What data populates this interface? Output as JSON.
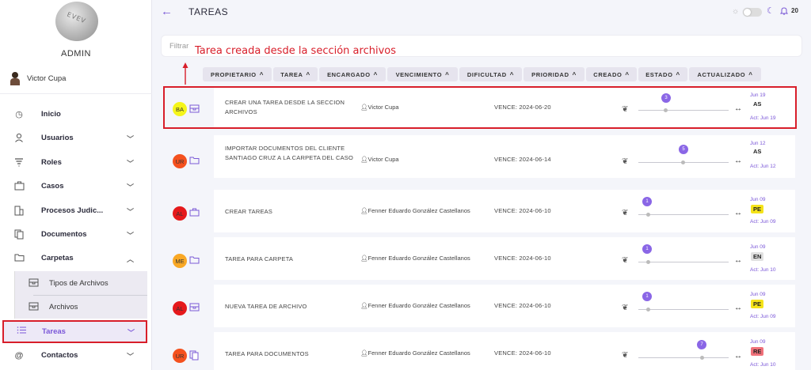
{
  "sidebar": {
    "admin_label": "ADMIN",
    "user_name": "Victor Cupa",
    "items": [
      {
        "label": "Inicio",
        "icon": "clock-icon"
      },
      {
        "label": "Usuarios",
        "icon": "user-icon"
      },
      {
        "label": "Roles",
        "icon": "roles-icon"
      },
      {
        "label": "Casos",
        "icon": "briefcase-icon"
      },
      {
        "label": "Procesos Judic...",
        "icon": "building-icon"
      },
      {
        "label": "Documentos",
        "icon": "documents-icon"
      },
      {
        "label": "Carpetas",
        "icon": "folder-icon"
      },
      {
        "label": "Tareas",
        "icon": "list-icon"
      },
      {
        "label": "Contactos",
        "icon": "at-icon"
      }
    ],
    "sub_items": [
      {
        "label": "Tipos de Archivos",
        "icon": "archive-box-icon"
      },
      {
        "label": "Archivos",
        "icon": "archive-box-icon"
      }
    ]
  },
  "header": {
    "title": "TAREAS",
    "notifications": "20"
  },
  "filter": {
    "placeholder": "Filtrar"
  },
  "annotation": "Tarea creada desde la sección archivos",
  "columns": [
    "PROPIETARIO",
    "TAREA",
    "ENCARGADO",
    "VENCIMIENTO",
    "DIFICULTAD",
    "PRIORIDAD",
    "CREADO",
    "ESTADO",
    "ACTUALIZADO"
  ],
  "rows": [
    {
      "initials": "BA",
      "badge_color": "#f5f51a",
      "type_icon": "archive-box-icon",
      "title": "CREAR UNA TAREA DESDE LA SECCION ARCHIVOS",
      "owner": "Victor Cupa",
      "due": "VENCE: 2024-06-20",
      "priority_label": "3",
      "priority": 3,
      "created": "Jun 19",
      "status": "AS",
      "status_color": "#ffffff",
      "updated": "Act: Jun 19"
    },
    {
      "initials": "UR",
      "badge_color": "#f4511e",
      "type_icon": "folder-icon",
      "title": "IMPORTAR DOCUMENTOS DEL CLIENTE SANTIAGO CRUZ A LA CARPETA DEL CASO",
      "owner": "Victor Cupa",
      "due": "VENCE: 2024-06-14",
      "priority_label": "5",
      "priority": 5,
      "created": "Jun 12",
      "status": "AS",
      "status_color": "#ffffff",
      "updated": "Act: Jun 12"
    },
    {
      "initials": "AL",
      "badge_color": "#e5191b",
      "type_icon": "briefcase-icon",
      "title": "CREAR TAREAS",
      "owner": "Fenner Eduardo González Castellanos",
      "due": "VENCE: 2024-06-10",
      "priority_label": "1",
      "priority": 1,
      "created": "Jun 09",
      "status": "PE",
      "status_color": "#f5e31a",
      "updated": "Act: Jun 09"
    },
    {
      "initials": "ME",
      "badge_color": "#f9a825",
      "type_icon": "folder-icon",
      "title": "TAREA PARA CARPETA",
      "owner": "Fenner Eduardo González Castellanos",
      "due": "VENCE: 2024-06-10",
      "priority_label": "1",
      "priority": 1,
      "created": "Jun 09",
      "status": "EN",
      "status_color": "#e0e0e0",
      "updated": "Act: Jun 10"
    },
    {
      "initials": "AL",
      "badge_color": "#e5191b",
      "type_icon": "archive-box-icon",
      "title": "NUEVA TAREA DE ARCHIVO",
      "owner": "Fenner Eduardo González Castellanos",
      "due": "VENCE: 2024-06-10",
      "priority_label": "1",
      "priority": 1,
      "created": "Jun 09",
      "status": "PE",
      "status_color": "#f5e31a",
      "updated": "Act: Jun 09"
    },
    {
      "initials": "UR",
      "badge_color": "#f4511e",
      "type_icon": "documents-icon",
      "title": "TAREA PARA DOCUMENTOS",
      "owner": "Fenner Eduardo González Castellanos",
      "due": "VENCE: 2024-06-10",
      "priority_label": "7",
      "priority": 7,
      "created": "Jun 09",
      "status": "RE",
      "status_color": "#f0717a",
      "updated": "Act: Jun 10"
    }
  ],
  "colors": {
    "accent": "#7b5ad6",
    "highlight": "#d81e2a"
  }
}
